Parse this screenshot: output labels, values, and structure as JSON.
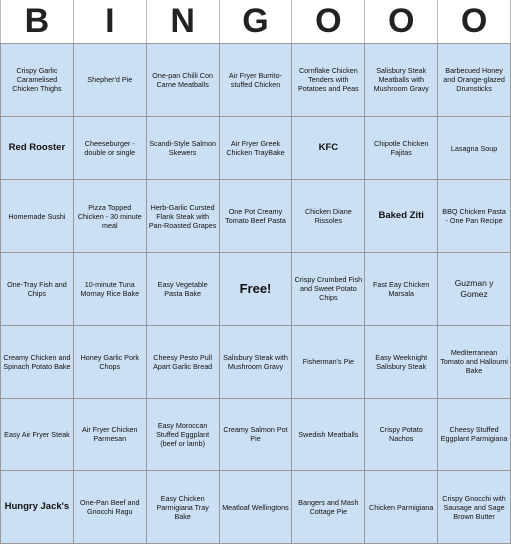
{
  "header": {
    "letters": [
      "B",
      "I",
      "N",
      "G",
      "O",
      "O",
      "O"
    ]
  },
  "grid": [
    [
      "Crispy Garlic Caramelised Chicken Thighs",
      "Shepher'd Pie",
      "One-pan Chilli Con Carne Meatballs",
      "Air Fryer Burrito-stuffed Chicken",
      "Cornflake Chicken Tenders with Potatoes and Peas",
      "Salisbury Steak Meatballs with Mushroom Gravy",
      "Barbecued Honey and Orange-glazed Drumsticks"
    ],
    [
      "Red Rooster",
      "Cheeseburger - double or single",
      "Scandi-Style Salmon Skewers",
      "Air Fryer Greek Chicken TrayBake",
      "KFC",
      "Chipotle Chicken Fajitas",
      "Lasagna Soup"
    ],
    [
      "Homemade Sushi",
      "Pizza Topped Chicken - 30 minute meal",
      "Herb-Garlic Cursted Flank Steak with Pan-Roasted Grapes",
      "One Pot Creamy Tomato Beef Pasta",
      "Chicken Diane Rissoles",
      "Baked Ziti",
      "BBQ Chicken Pasta - One Pan Recipe"
    ],
    [
      "One-Tray Fish and Chips",
      "10-minute Tuna Mornay Rice Bake",
      "Easy Vegetable Pasta Bake",
      "Free!",
      "Crispy Crumbed Fish and Sweet Potato Chips",
      "Fast Eay Chicken Marsala",
      "Guzman y Gomez"
    ],
    [
      "Creamy Chicken and Spinach Potato Bake",
      "Honey Garlic Pork Chops",
      "Cheesy Pesto Pull Apart Garlic Bread",
      "Salisbury Steak with Mushroom Gravy",
      "Fisherman's Pie",
      "Easy Weeknight Salisbury Steak",
      "Mediterranean Tomato and Halloumi Bake"
    ],
    [
      "Easy Air Fryer Steak",
      "Air Fryer Chicken Parmesan",
      "Easy Moroccan Stuffed Eggplant (beef or lamb)",
      "Creamy Salmon Pot Pie",
      "Swedish Meatballs",
      "Crispy Potato Nachos",
      "Cheesy Stuffed Eggplant Parmigiana"
    ],
    [
      "Hungry Jack's",
      "One-Pan Beef and Gnocchi Ragu",
      "Easy Chicken Parmigiana Tray Bake",
      "Meatloaf Wellingtons",
      "Bangers and Mash Cottage Pie",
      "Chicken Parmigiana",
      "Crispy Gnocchi with Sausage and Sage Brown Butter"
    ]
  ]
}
